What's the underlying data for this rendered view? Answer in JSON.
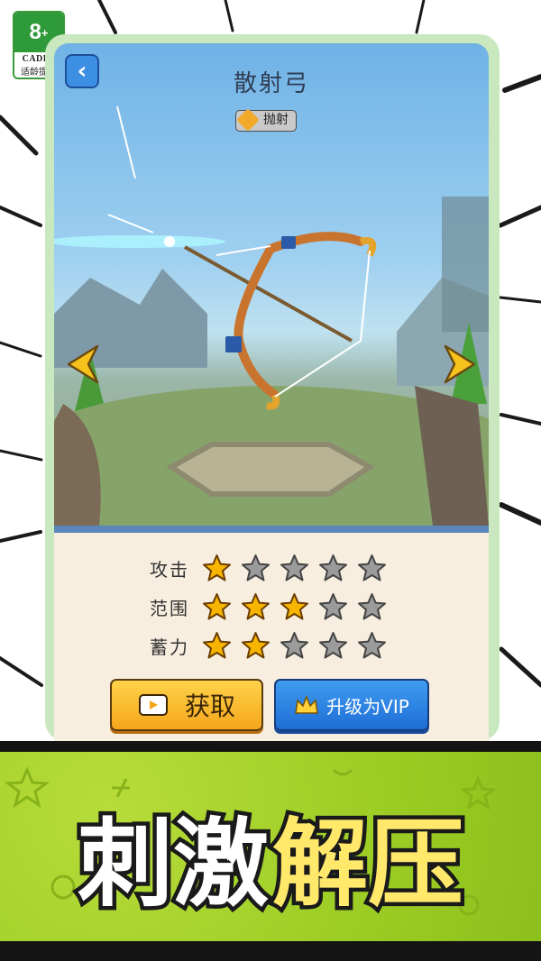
{
  "age_rating": {
    "value": "8",
    "plus": "+",
    "org": "CADPA",
    "note": "适龄提示"
  },
  "header": {
    "back_icon": "chevron-left-icon",
    "title": "散射弓",
    "tag_label": "抛射",
    "tag_icon": "crosshair-icon"
  },
  "stats": [
    {
      "label": "攻击",
      "rating": 1,
      "max": 5
    },
    {
      "label": "范围",
      "rating": 3,
      "max": 5
    },
    {
      "label": "蓄力",
      "rating": 2,
      "max": 5
    }
  ],
  "buttons": {
    "get_label": "获取",
    "get_icon": "video-camera-icon",
    "vip_label": "升级为VIP",
    "vip_icon": "crown-icon"
  },
  "banner": {
    "word1": "刺激",
    "word2": "解压"
  },
  "colors": {
    "star_filled": "#f7b500",
    "star_empty": "#9b9b9b",
    "get_button": "#f5b52a",
    "vip_button": "#2f86e8",
    "banner": "#9ccd24"
  }
}
